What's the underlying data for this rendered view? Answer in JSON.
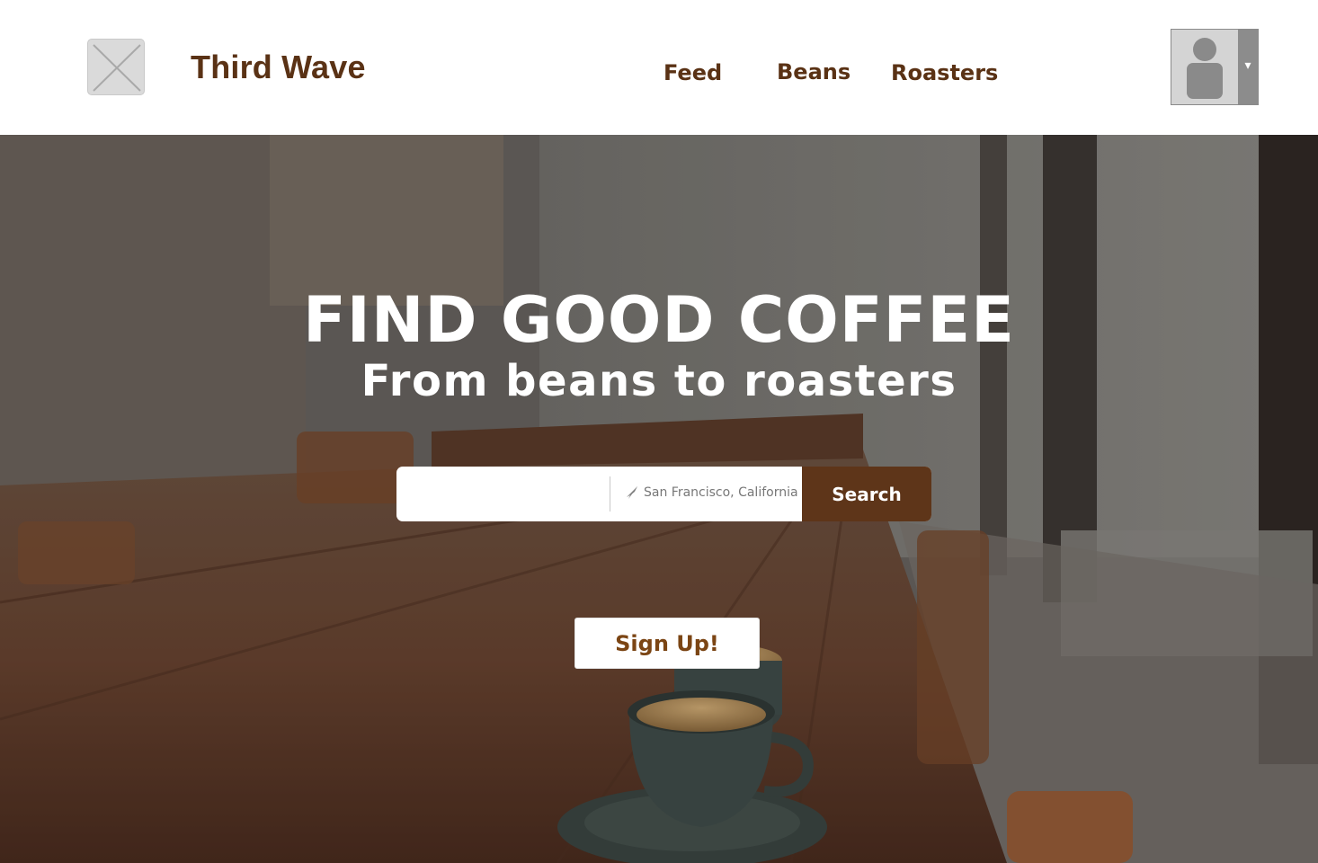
{
  "header": {
    "brand": "Third Wave",
    "logo_icon": "image-placeholder-icon",
    "nav": [
      {
        "label": "Feed"
      },
      {
        "label": "Beans"
      },
      {
        "label": "Roasters"
      }
    ],
    "avatar_icon": "user-avatar-icon",
    "dropdown_glyph": "▾"
  },
  "hero": {
    "title": "FIND GOOD COFFEE",
    "subtitle": "From beans to roasters",
    "search": {
      "query_value": "",
      "location": "San Francisco, California",
      "location_icon": "location-arrow-icon",
      "button_label": "Search"
    },
    "signup_label": "Sign Up!"
  },
  "colors": {
    "brand_brown": "#5a3215",
    "button_brown": "#5e3519",
    "signup_text": "#7b4514"
  }
}
